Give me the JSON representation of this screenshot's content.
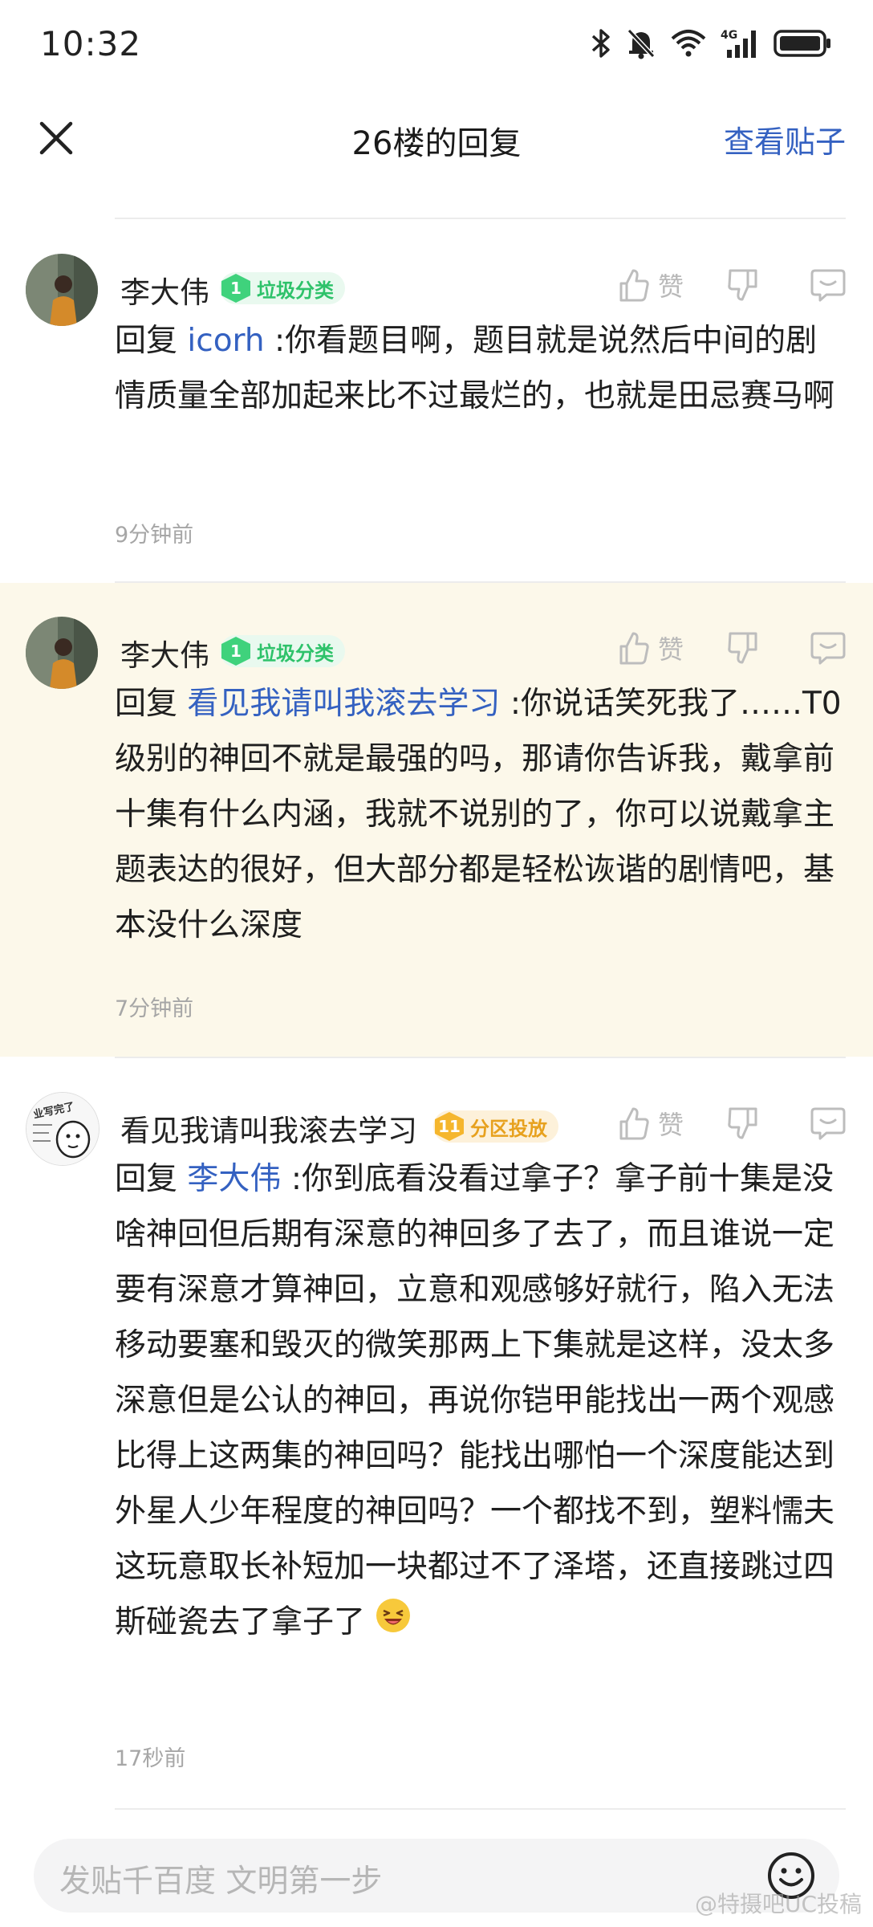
{
  "status_bar": {
    "time": "10:32"
  },
  "nav": {
    "title": "26楼的回复",
    "view_post": "查看贴子"
  },
  "replies": [
    {
      "username": "李大伟",
      "badge_level": "1",
      "badge_text": "垃圾分类",
      "like_label": "赞",
      "reply_prefix": "回复",
      "mention": "icorh",
      "text": ":你看题目啊，题目就是说然后中间的剧情质量全部加起来比不过最烂的，也就是田忌赛马啊",
      "time": "9分钟前"
    },
    {
      "username": "李大伟",
      "badge_level": "1",
      "badge_text": "垃圾分类",
      "like_label": "赞",
      "reply_prefix": "回复",
      "mention": "看见我请叫我滚去学习",
      "text": ":你说话笑死我了……T0级别的神回不就是最强的吗，那请你告诉我，戴拿前十集有什么内涵，我就不说别的了，你可以说戴拿主题表达的很好，但大部分都是轻松诙谐的剧情吧，基本没什么深度",
      "time": "7分钟前"
    },
    {
      "username": "看见我请叫我滚去学习",
      "badge_level": "11",
      "badge_text": "分区投放",
      "like_label": "赞",
      "reply_prefix": "回复",
      "mention": "李大伟",
      "text": ":你到底看没看过拿子？拿子前十集是没啥神回但后期有深意的神回多了去了，而且谁说一定要有深意才算神回，立意和观感够好就行，陷入无法移动要塞和毁灭的微笑那两上下集就是这样，没太多深意但是公认的神回，再说你铠甲能找出一两个观感比得上这两集的神回吗？能找出哪怕一个深度能达到外星人少年程度的神回吗？一个都找不到，塑料懦夫这玩意取长补短加一块都过不了泽塔，还直接跳过四斯碰瓷去了拿子了",
      "time": "17秒前",
      "avatar_text": "业写完了"
    }
  ],
  "input": {
    "placeholder": "发贴千百度 文明第一步"
  },
  "watermark": "@特摄吧UC投稿",
  "colors": {
    "accent": "#3461c1",
    "highlight_bg": "#fcf8ea",
    "badge_green": "#2ec26a",
    "badge_gold": "#e7a11e"
  }
}
